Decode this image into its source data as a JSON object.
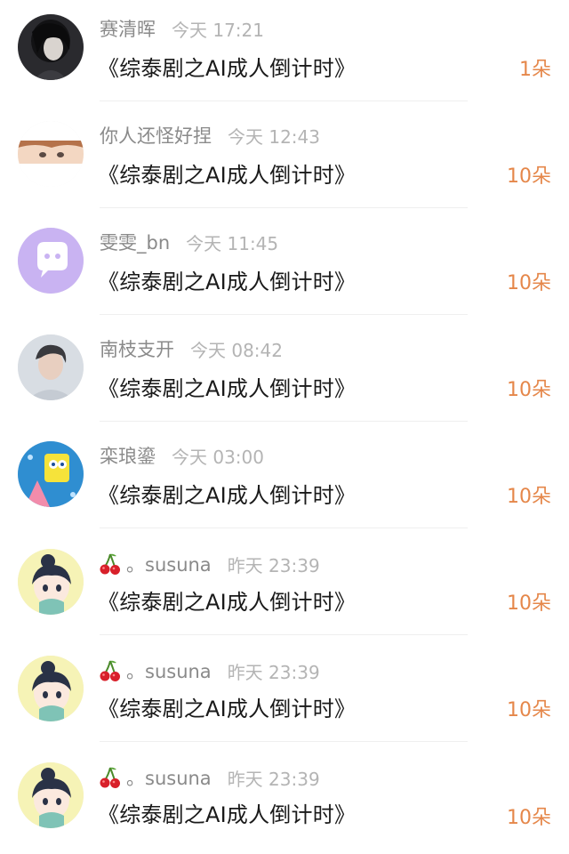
{
  "comments": [
    {
      "avatar": "avatar-dark-hair-photo",
      "name": "赛清晖",
      "time": "今天 17:21",
      "title": "《综泰剧之AI成人倒计时》",
      "gift": "1朵",
      "emoji": ""
    },
    {
      "avatar": "avatar-anime-boy-cropped",
      "name": "你人还怪好捏",
      "time": "今天 12:43",
      "title": "《综泰剧之AI成人倒计时》",
      "gift": "10朵",
      "emoji": ""
    },
    {
      "avatar": "avatar-purple-chat-bubble",
      "name": "雯雯_bn",
      "time": "今天 11:45",
      "title": "《综泰剧之AI成人倒计时》",
      "gift": "10朵",
      "emoji": ""
    },
    {
      "avatar": "avatar-man-portrait",
      "name": "南枝支开",
      "time": "今天 08:42",
      "title": "《综泰剧之AI成人倒计时》",
      "gift": "10朵",
      "emoji": ""
    },
    {
      "avatar": "avatar-spongebob-cartoon",
      "name": "栾琅鎏",
      "time": "今天 03:00",
      "title": "《综泰剧之AI成人倒计时》",
      "gift": "10朵",
      "emoji": ""
    },
    {
      "avatar": "avatar-cartoon-girl-bun",
      "name": "。susuna",
      "time": "昨天 23:39",
      "title": "《综泰剧之AI成人倒计时》",
      "gift": "10朵",
      "emoji": "cherry-icon"
    },
    {
      "avatar": "avatar-cartoon-girl-bun",
      "name": "。susuna",
      "time": "昨天 23:39",
      "title": "《综泰剧之AI成人倒计时》",
      "gift": "10朵",
      "emoji": "cherry-icon"
    },
    {
      "avatar": "avatar-cartoon-girl-bun",
      "name": "。susuna",
      "time": "昨天 23:39",
      "title": "《综泰剧之AI成人倒计时》",
      "gift": "10朵",
      "emoji": "cherry-icon"
    }
  ],
  "colors": {
    "username": "#8a8a8a",
    "time": "#b4b4b4",
    "title": "#1a1a1a",
    "gift": "#e5874a",
    "divider": "#efefef"
  }
}
